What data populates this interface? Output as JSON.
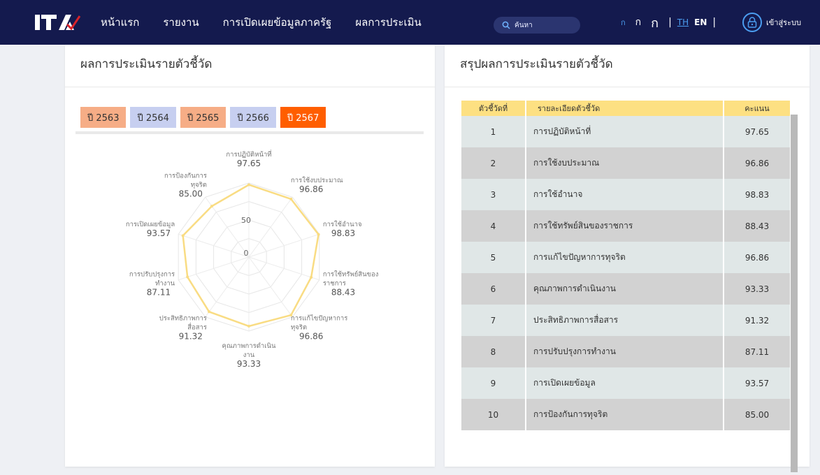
{
  "nav": {
    "items": [
      "หน้าแรก",
      "รายงาน",
      "การเปิดเผยข้อมูลภาครัฐ",
      "ผลการประเมิน"
    ],
    "search_placeholder": "ค้นหา",
    "font_sizes": [
      "ก",
      "ก",
      "ก"
    ],
    "separator": "|",
    "lang_th": "TH",
    "lang_en": "EN",
    "login_label": "เข้าสู่ระบบ"
  },
  "left": {
    "title": "ผลการประเมินรายตัวชี้วัด",
    "years": [
      "ปี 2563",
      "ปี 2564",
      "ปี 2565",
      "ปี 2566",
      "ปี 2567"
    ],
    "active_year_index": 4
  },
  "chart_data": {
    "type": "radar",
    "title": "",
    "r_ticks": [
      "0",
      "50"
    ],
    "rlim": [
      0,
      100
    ],
    "line_color": "#f9dc83",
    "categories": [
      [
        "การปฏิบัติหน้าที่"
      ],
      [
        "การใช้งบประมาณ"
      ],
      [
        "การใช้อำนาจ"
      ],
      [
        "การใช้ทรัพย์สินของ",
        "ราชการ"
      ],
      [
        "การแก้ไขปัญหาการ",
        "ทุจริต"
      ],
      [
        "คุณภาพการดำเนิน",
        "งาน"
      ],
      [
        "ประสิทธิภาพการ",
        "สื่อสาร"
      ],
      [
        "การปรับปรุงการ",
        "ทำงาน"
      ],
      [
        "การเปิดเผยข้อมูล"
      ],
      [
        "การป้องกันการ",
        "ทุจริต"
      ]
    ],
    "values": [
      97.65,
      96.86,
      98.83,
      88.43,
      96.86,
      93.33,
      91.32,
      87.11,
      93.57,
      85.0
    ],
    "value_labels": [
      "97.65",
      "96.86",
      "98.83",
      "88.43",
      "96.86",
      "93.33",
      "91.32",
      "87.11",
      "93.57",
      "85.00"
    ]
  },
  "right": {
    "title": "สรุปผลการประเมินรายตัวชี้วัด",
    "headers": [
      "ตัวชี้วัดที่",
      "รายละเอียดตัวชี้วัด",
      "คะแนน"
    ],
    "rows": [
      [
        "1",
        "การปฏิบัติหน้าที่",
        "97.65"
      ],
      [
        "2",
        "การใช้งบประมาณ",
        "96.86"
      ],
      [
        "3",
        "การใช้อำนาจ",
        "98.83"
      ],
      [
        "4",
        "การใช้ทรัพย์สินของราชการ",
        "88.43"
      ],
      [
        "5",
        "การแก้ไขปัญหาการทุจริต",
        "96.86"
      ],
      [
        "6",
        "คุณภาพการดำเนินงาน",
        "93.33"
      ],
      [
        "7",
        "ประสิทธิภาพการสื่อสาร",
        "91.32"
      ],
      [
        "8",
        "การปรับปรุงการทำงาน",
        "87.11"
      ],
      [
        "9",
        "การเปิดเผยข้อมูล",
        "93.57"
      ],
      [
        "10",
        "การป้องกันการทุจริต",
        "85.00"
      ]
    ]
  },
  "colors": {
    "nav_bg": "#141a4e",
    "accent": "#4b9df0",
    "year_orange": "#f6ad86",
    "year_blue": "#c7cff0",
    "year_active": "#ff5e00",
    "table_header": "#fde082"
  }
}
